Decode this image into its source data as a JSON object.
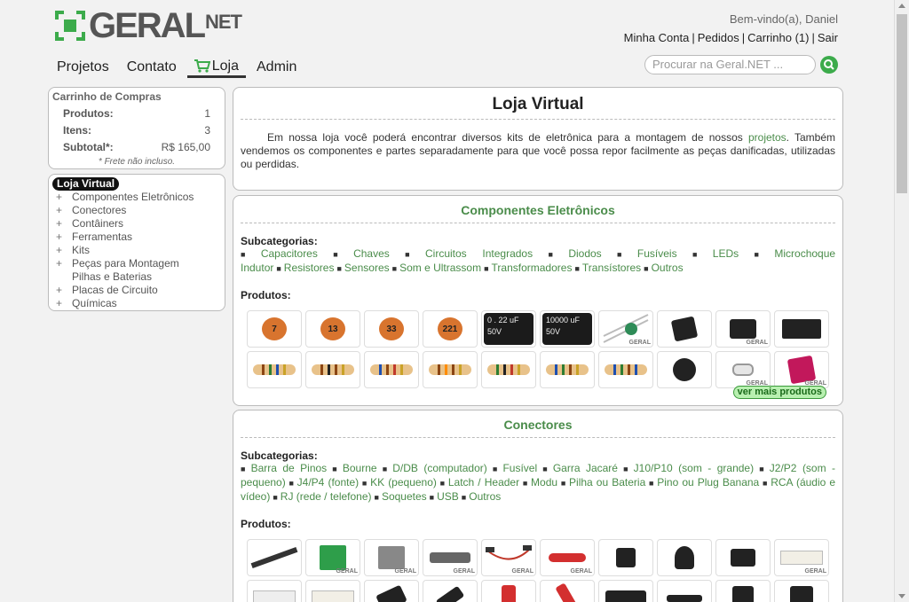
{
  "header": {
    "logo_text": "GERAL",
    "logo_suffix": "NET",
    "welcome": "Bem-vindo(a), Daniel",
    "user_links": [
      "Minha Conta",
      "Pedidos",
      "Carrinho (1)",
      "Sair"
    ],
    "search_placeholder": "Procurar na Geral.NET ..."
  },
  "nav": {
    "items": [
      "Projetos",
      "Contato",
      "Loja",
      "Admin"
    ],
    "active": "Loja"
  },
  "cart": {
    "title": "Carrinho de Compras",
    "rows": [
      {
        "label": "Produtos:",
        "value": "1"
      },
      {
        "label": "Itens:",
        "value": "3"
      },
      {
        "label": "Subtotal*:",
        "value": "R$ 165,00"
      }
    ],
    "note": "* Frete não incluso."
  },
  "categories": {
    "title": "Loja Virtual",
    "items": [
      {
        "label": "Componentes Eletrônicos",
        "plus": "+"
      },
      {
        "label": "Conectores",
        "plus": "+"
      },
      {
        "label": "Contâiners",
        "plus": "+"
      },
      {
        "label": "Ferramentas",
        "plus": "+"
      },
      {
        "label": "Kits",
        "plus": "+"
      },
      {
        "label": "Peças para Montagem",
        "plus": "+"
      },
      {
        "label": "Pilhas e Baterias",
        "plus": ""
      },
      {
        "label": "Placas de Circuito",
        "plus": "+"
      },
      {
        "label": "Químicas",
        "plus": "+"
      }
    ]
  },
  "intro": {
    "title": "Loja Virtual",
    "text_before": "Em nossa loja você poderá encontrar diversos kits de eletrônica para a montagem de nossos ",
    "link": "projetos",
    "text_after": ". Também vendemos os componentes e partes separadamente para que você possa repor facilmente as peças danificadas, utilizadas ou perdidas."
  },
  "sections": [
    {
      "title": "Componentes Eletrônicos",
      "subcat_label": "Subcategorias:",
      "subcats": [
        "Capacitores",
        "Chaves",
        "Circuitos Integrados",
        "Diodos",
        "Fusíveis",
        "LEDs",
        "Microchoque Indutor",
        "Resistores",
        "Sensores",
        "Som e Ultrassom",
        "Transformadores",
        "Transístores",
        "Outros"
      ],
      "products_label": "Produtos:",
      "more_label": "ver mais produtos",
      "cap_labels": [
        "7",
        "13",
        "33",
        "221"
      ],
      "elec_labels": [
        {
          "top": "0 . 22 uF",
          "bottom": "50V"
        },
        {
          "top": "10000 uF",
          "bottom": "50V"
        }
      ]
    },
    {
      "title": "Conectores",
      "subcat_label": "Subcategorias:",
      "subcats": [
        "Barra de Pinos",
        "Bourne",
        "D/DB (computador)",
        "Fusível",
        "Garra Jacaré",
        "J10/P10 (som - grande)",
        "J2/P2 (som - pequeno)",
        "J4/P4 (fonte)",
        "KK (pequeno)",
        "Latch / Header",
        "Modu",
        "Pilha ou Bateria",
        "Pino ou Plug Banana",
        "RCA (áudio e vídeo)",
        "RJ (rede / telefone)",
        "Soquetes",
        "USB",
        "Outros"
      ],
      "products_label": "Produtos:"
    }
  ],
  "watermark": "GERAL",
  "colors": {
    "accent": "#4a8c4a",
    "search_button": "#3cab4b"
  }
}
